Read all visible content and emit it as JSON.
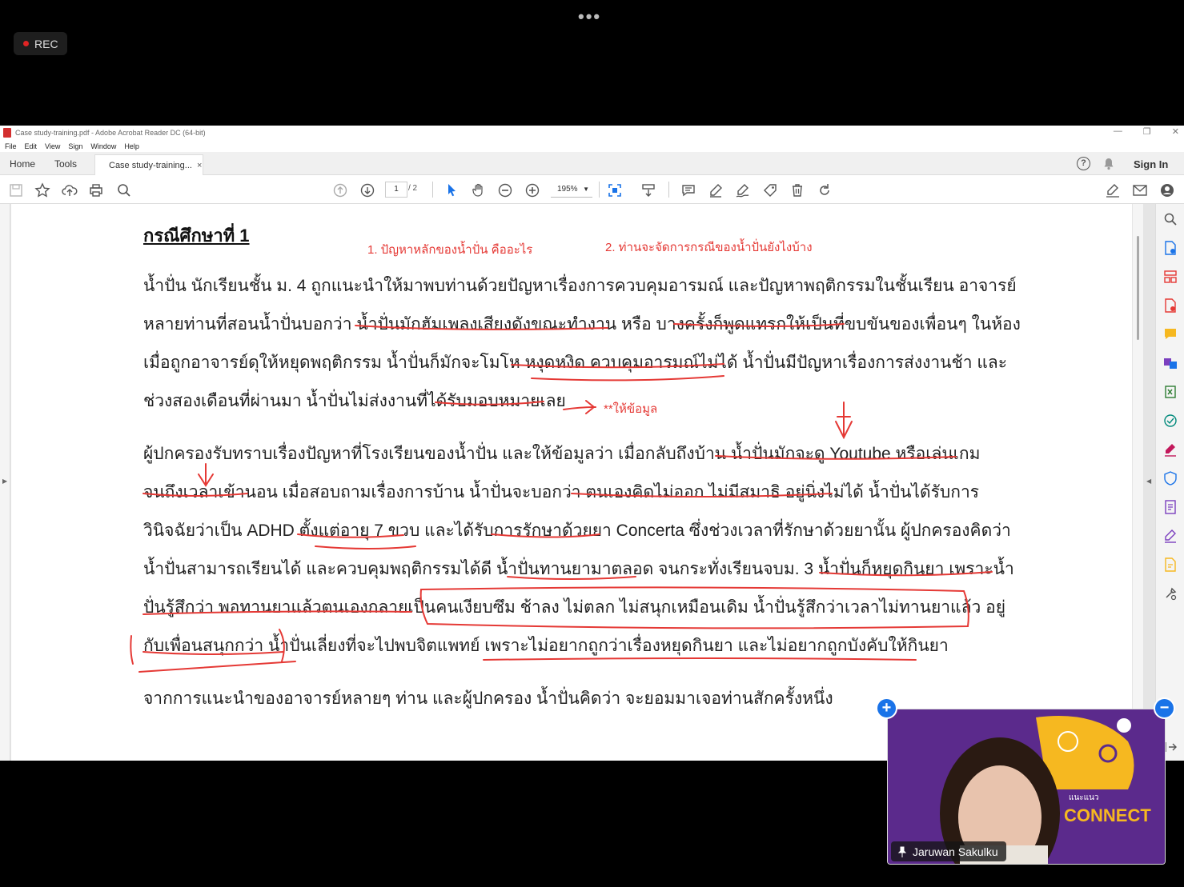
{
  "meeting": {
    "more_label": "•••",
    "rec_label": "REC",
    "participant_name": "Jaruwan Sakulku",
    "add_label": "+",
    "minimize_label": "−",
    "video_brand_text": "CONNECT",
    "video_brand_prefix": "แนะแนว"
  },
  "window": {
    "title": "Case study-training.pdf - Adobe Acrobat Reader DC (64-bit)",
    "controls": [
      "—",
      "❐",
      "✕"
    ]
  },
  "menu": [
    "File",
    "Edit",
    "View",
    "Sign",
    "Window",
    "Help"
  ],
  "tabs": {
    "home": "Home",
    "tools": "Tools",
    "document": "Case study-training...",
    "close": "×",
    "help": "?",
    "sign_in": "Sign In"
  },
  "toolbar": {
    "page_current": "1",
    "page_total": "/ 2",
    "zoom": "195%"
  },
  "document": {
    "title": "กรณีศึกษาที่ 1",
    "annotations": {
      "q1": "1. ปัญหาหลักของน้ำปั่น คืออะไร",
      "q2": "2. ท่านจะจัดการกรณีของน้ำปั่นยังไงบ้าง",
      "note": "**ให้ข้อมูล"
    },
    "paragraph1": [
      "น้ำปั่น นักเรียนชั้น ม. 4 ถูกแนะนำให้มาพบท่านด้วยปัญหาเรื่องการควบคุมอารมณ์ และปัญหาพฤติกรรมในชั้นเรียน อาจารย์",
      "หลายท่านที่สอนน้ำปั่นบอกว่า น้ำปั่นมักฮัมเพลงเสียงดังขณะทำงาน หรือ บางครั้งก็พูดแทรกให้เป็นที่ขบขันของเพื่อนๆ ในห้อง",
      "เมื่อถูกอาจารย์ดุให้หยุดพฤติกรรม น้ำปั่นก็มักจะโมโห หงุดหงิด ควบคุมอารมณ์ไม่ได้ น้ำปั่นมีปัญหาเรื่องการส่งงานช้า และ",
      "ช่วงสองเดือนที่ผ่านมา น้ำปั่นไม่ส่งงานที่ได้รับมอบหมายเลย"
    ],
    "paragraph2": [
      "ผู้ปกครองรับทราบเรื่องปัญหาที่โรงเรียนของน้ำปั่น และให้ข้อมูลว่า เมื่อกลับถึงบ้าน น้ำปั่นมักจะดู Youtube หรือเล่นเกม",
      "จนถึงเวลาเข้านอน เมื่อสอบถามเรื่องการบ้าน น้ำปั่นจะบอกว่า ตนเองคิดไม่ออก ไม่มีสมาธิ อยู่นิ่งไม่ได้ น้ำปั่นได้รับการ",
      "วินิจฉัยว่าเป็น ADHD ตั้งแต่อายุ 7 ขวบ และได้รับการรักษาด้วยยา Concerta ซึ่งช่วงเวลาที่รักษาด้วยยานั้น ผู้ปกครองคิดว่า",
      "น้ำปั่นสามารถเรียนได้ และควบคุมพฤติกรรมได้ดี น้ำปั่นทานยามาตลอด จนกระทั่งเรียนจบม. 3 น้ำปั่นก็หยุดกินยา เพราะน้ำ",
      "ปั่นรู้สึกว่า พอทานยาแล้วตนเองกลายเป็นคนเงียบซึม ช้าลง ไม่ตลก ไม่สนุกเหมือนเดิม น้ำปั่นรู้สึกว่าเวลาไม่ทานยาแล้ว อยู่",
      "กับเพื่อนสนุกกว่า น้ำปั่นเลี่ยงที่จะไปพบจิตแพทย์ เพราะไม่อยากถูกว่าเรื่องหยุดกินยา และไม่อยากถูกบังคับให้กินยา"
    ],
    "paragraph3": "จากการแนะนำของอาจารย์หลายๆ ท่าน และผู้ปกครอง น้ำปั่นคิดว่า จะยอมมาเจอท่านสักครั้งหนึ่ง"
  },
  "colors": {
    "ink": "#e53935",
    "rec_dot": "#e02424",
    "video_bg": "#5b2a8c",
    "brand_yellow": "#f6b820"
  }
}
